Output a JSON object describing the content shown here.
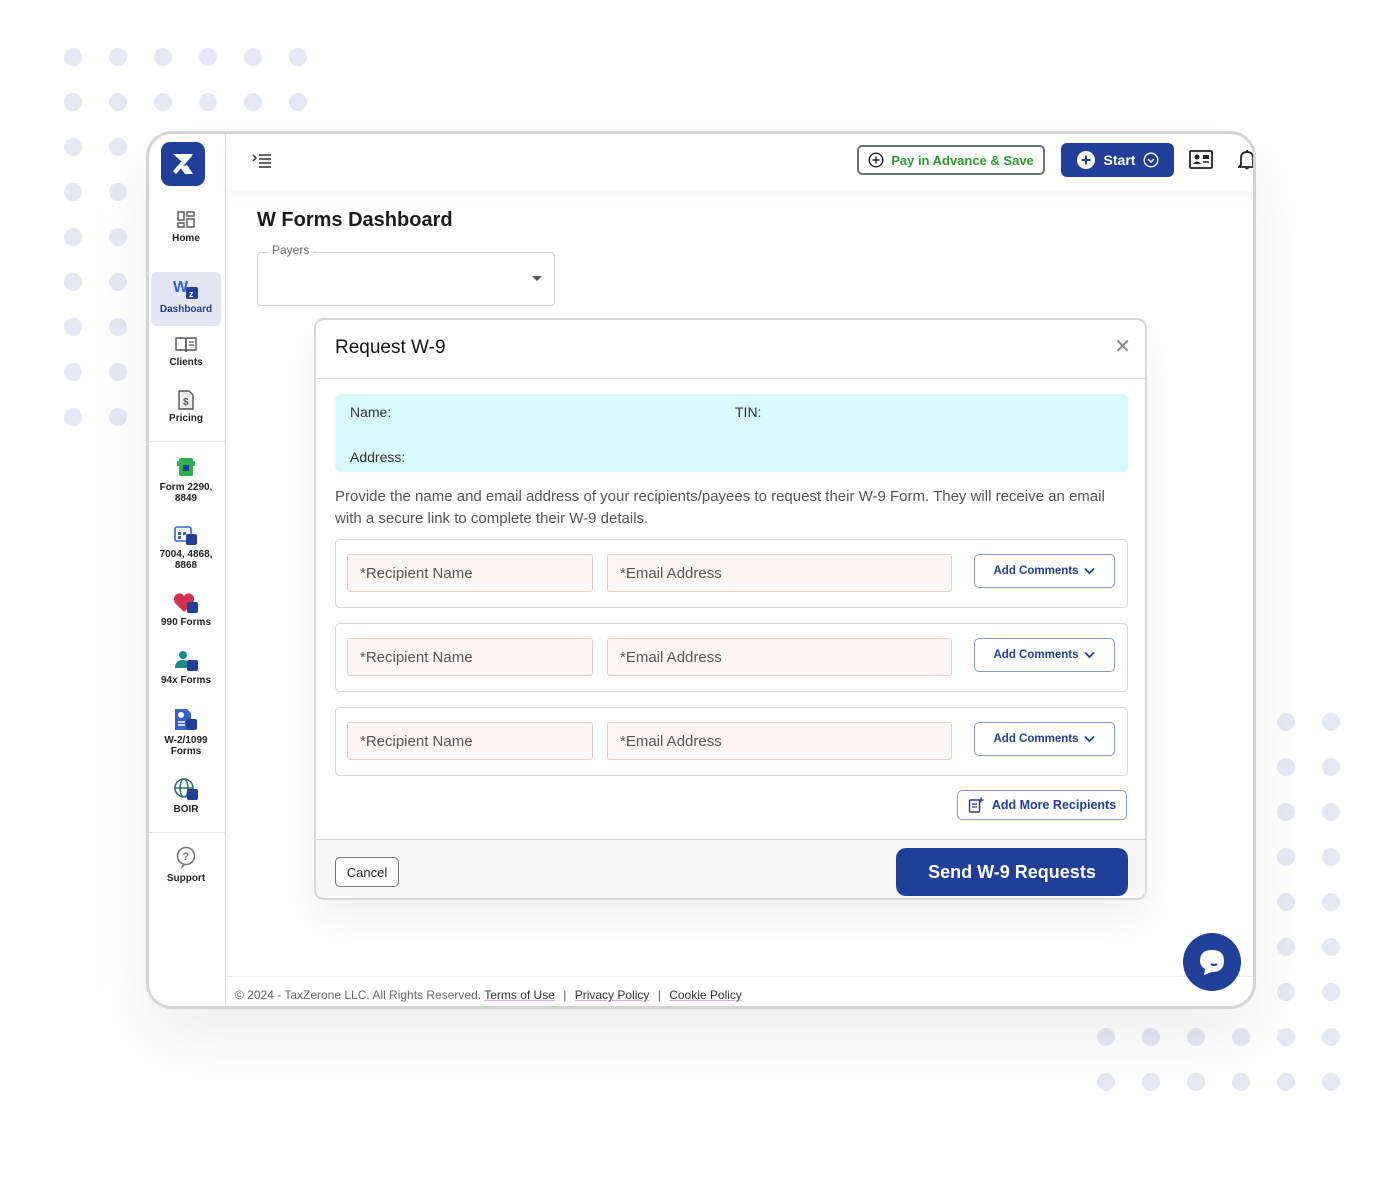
{
  "app": {
    "brand": "TaxZerone",
    "accent": "#213f99",
    "green": "#2c9a2f",
    "info_bg": "#d8f9fc"
  },
  "sidebar": {
    "items": [
      {
        "label": "Home",
        "icon": "home-grid-icon"
      },
      {
        "label": "Dashboard",
        "icon": "w-forms-icon",
        "active": true
      },
      {
        "label": "Clients",
        "icon": "book-icon"
      },
      {
        "label": "Pricing",
        "icon": "pricing-doc-icon"
      },
      {
        "label": "Form 2290, 8849",
        "icon": "truck-icon"
      },
      {
        "label": "7004, 4868, 8868",
        "icon": "calendar-icon"
      },
      {
        "label": "990 Forms",
        "icon": "heart-icon"
      },
      {
        "label": "94x Forms",
        "icon": "person-icon"
      },
      {
        "label": "W-2/1099 Forms",
        "icon": "document-info-icon"
      },
      {
        "label": "BOIR",
        "icon": "globe-icon"
      },
      {
        "label": "Support",
        "icon": "help-icon"
      }
    ]
  },
  "topbar": {
    "pay_advance_label": "Pay in Advance & Save",
    "start_label": "Start"
  },
  "page": {
    "title": "W Forms Dashboard",
    "payers_label": "Payers",
    "payers_value": ""
  },
  "modal": {
    "title": "Request W-9",
    "info": {
      "name_label": "Name:",
      "tin_label": "TIN:",
      "address_label": "Address:"
    },
    "description": "Provide the name and email address of your recipients/payees to request their W-9 Form. They will receive an email with a secure link to complete their W-9 details.",
    "recipients": [
      {
        "name_placeholder": "*Recipient Name",
        "email_placeholder": "*Email Address",
        "comments_label": "Add Comments"
      },
      {
        "name_placeholder": "*Recipient Name",
        "email_placeholder": "*Email Address",
        "comments_label": "Add Comments"
      },
      {
        "name_placeholder": "*Recipient Name",
        "email_placeholder": "*Email Address",
        "comments_label": "Add Comments"
      }
    ],
    "add_more_label": "Add More Recipients",
    "cancel_label": "Cancel",
    "send_label": "Send W-9 Requests"
  },
  "footer": {
    "copyright": "© 2024 - TaxZerone LLC. All Rights Reserved.",
    "links": [
      "Terms of Use",
      "Privacy Policy",
      "Cookie Policy"
    ],
    "separator": "|"
  }
}
